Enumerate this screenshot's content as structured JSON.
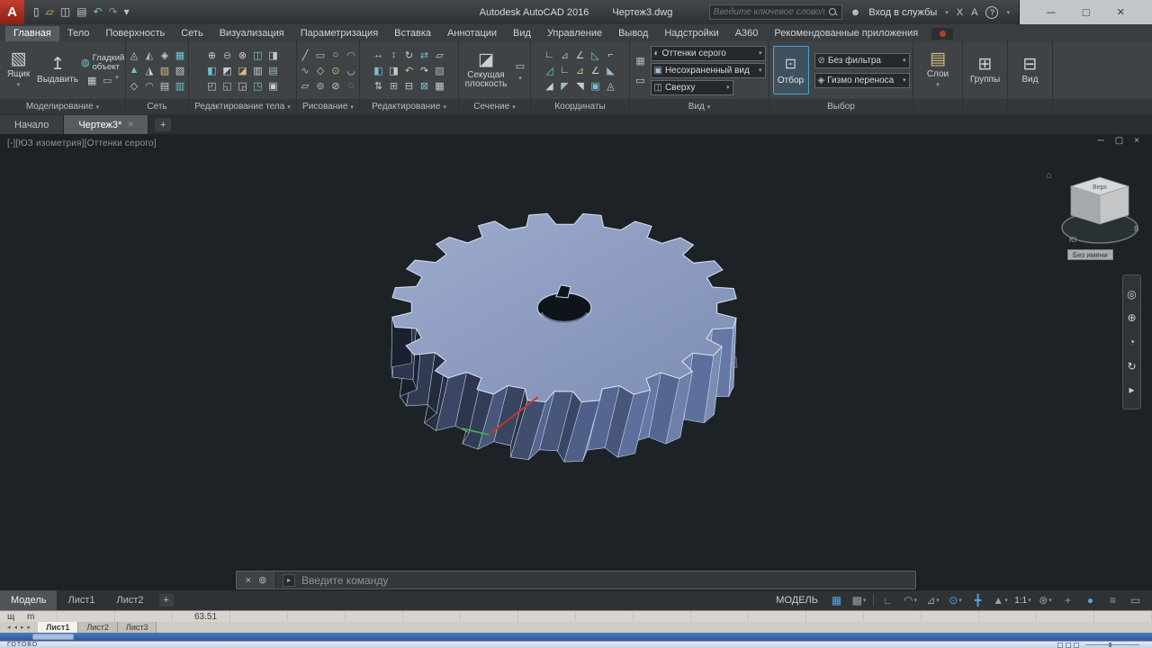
{
  "ui": {
    "caret": "▾",
    "close": "×",
    "plus": "+",
    "minimize": "─",
    "maximize": "□",
    "restore": "▢"
  },
  "colors": {
    "accent_blue": "#4da6e8",
    "gear_body": "#8e9dc1",
    "viewport_bg": "#1d2226",
    "logo_red": "#c43d31"
  },
  "titlebar": {
    "logo": "A",
    "qat": [
      {
        "name": "new-file",
        "g": "▯",
        "c": "#d9dcde"
      },
      {
        "name": "open-file",
        "g": "▱",
        "c": "#d8b65c"
      },
      {
        "name": "save-file",
        "g": "◫",
        "c": "#c7d6e4"
      },
      {
        "name": "plot",
        "g": "▤",
        "c": "#c0c5c9"
      },
      {
        "name": "undo",
        "g": "↶",
        "c": "#64c7d2"
      },
      {
        "name": "redo",
        "g": "↷",
        "c": "#8b9196"
      },
      {
        "name": "qat-menu",
        "g": "▾",
        "c": "#c0c5c9"
      }
    ],
    "app_title": "Autodesk AutoCAD 2016",
    "doc_title": "Чертеж3.dwg",
    "search_placeholder": "Введите ключевое слово/фразу",
    "signin": "Вход в службы",
    "exchange_glyph": "Χ",
    "a360_glyph": "A",
    "help_glyph": "?"
  },
  "ribbon_tabs": [
    {
      "label": "Главная",
      "active": true
    },
    {
      "label": "Тело"
    },
    {
      "label": "Поверхность"
    },
    {
      "label": "Сеть"
    },
    {
      "label": "Визуализация"
    },
    {
      "label": "Параметризация"
    },
    {
      "label": "Вставка"
    },
    {
      "label": "Аннотации"
    },
    {
      "label": "Вид"
    },
    {
      "label": "Управление"
    },
    {
      "label": "Вывод"
    },
    {
      "label": "Надстройки"
    },
    {
      "label": "A360"
    },
    {
      "label": "Рекомендованные приложения"
    }
  ],
  "icons": {
    "box": "▧",
    "extrude": "↥",
    "smooth": "◍",
    "section": "◪",
    "visual_style": "◐",
    "named_view": "▣",
    "plan_view": "◫",
    "cycle": "⊡",
    "no_filter": "⊘",
    "gizmo": "◈",
    "layers": "▤",
    "groups": "⊞",
    "viewport_cfg": "⊟",
    "small_a": "▭",
    "small_b": "▦"
  },
  "panels": {
    "modeling": {
      "label": "Моделирование",
      "box": "Ящик",
      "extrude": "Выдавить",
      "smooth": "Гладкий объект"
    },
    "mesh": {
      "label": "Сеть",
      "rows": [
        [
          "◬",
          "◭",
          "◈",
          "▦"
        ],
        [
          "▲",
          "◮",
          "▨",
          "▧"
        ],
        [
          "◇",
          "◠",
          "▤",
          "▥"
        ]
      ]
    },
    "solid_edit": {
      "label": "Редактирование тела",
      "rows": [
        [
          "⊕",
          "⊖",
          "⊗",
          "◫",
          "◨"
        ],
        [
          "◧",
          "◩",
          "◪",
          "▥",
          "▤"
        ],
        [
          "◰",
          "◱",
          "◲",
          "◳",
          "▣"
        ]
      ]
    },
    "draw": {
      "label": "Рисование",
      "rows": [
        [
          "╱",
          "▭",
          "○",
          "◠"
        ],
        [
          "∿",
          "◇",
          "⊙",
          "◡"
        ],
        [
          "▱",
          "⊚",
          "⊘",
          "◌"
        ]
      ]
    },
    "modify": {
      "label": "Редактирование",
      "rows": [
        [
          "↔",
          "↕",
          "↻",
          "⇄",
          "▱"
        ],
        [
          "◧",
          "◨",
          "↶",
          "↷",
          "▨"
        ],
        [
          "⇅",
          "⊞",
          "⊟",
          "⊠",
          "▦"
        ]
      ]
    },
    "section": {
      "label": "Сечение",
      "big": "Секущая плоскость"
    },
    "coords": {
      "label": "Координаты",
      "rows": [
        [
          "∟",
          "⊿",
          "∠",
          "◺",
          "⌐"
        ],
        [
          "◿",
          "∟",
          "⊿",
          "∠",
          "◣"
        ],
        [
          "◢",
          "◤",
          "◥",
          "▣",
          "◬"
        ]
      ]
    },
    "view": {
      "label": "Вид",
      "combos": [
        {
          "value": "Оттенки серого"
        },
        {
          "value": "Несохраненный вид"
        },
        {
          "value": "Сверху"
        }
      ]
    },
    "selection": {
      "label": "Выбор",
      "cycle": "Отбор",
      "filter": "Без фильтра",
      "gizmo": "Гизмо переноса"
    },
    "layers": {
      "big": "Слои"
    },
    "groups": {
      "big": "Группы"
    },
    "view2": {
      "big": "Вид"
    }
  },
  "file_tabs": [
    {
      "label": "Начало"
    },
    {
      "label": "Чертеж3*",
      "active": true
    }
  ],
  "viewport": {
    "label": "[-][ЮЗ изометрия][Оттенки серого]",
    "viewcube_top": "Верх",
    "viewcube_unnamed": "Без имени",
    "compass_e": "В",
    "compass_s": "Ю",
    "nav_icons": [
      {
        "name": "navigation-wheel-icon",
        "g": "◎"
      },
      {
        "name": "pan-icon",
        "g": "⊕"
      },
      {
        "name": "zoom-icon",
        "g": "◔"
      },
      {
        "name": "orbit-icon",
        "g": "↻"
      },
      {
        "name": "showmotion-icon",
        "g": "▸"
      }
    ]
  },
  "command": {
    "close": "×",
    "customize": "⊚",
    "prompt": "▸",
    "placeholder": "Введите команду"
  },
  "statusbar": {
    "tabs": [
      {
        "label": "Модель",
        "active": true
      },
      {
        "label": "Лист1"
      },
      {
        "label": "Лист2"
      }
    ],
    "add": "+",
    "mode": "МОДЕЛЬ",
    "icons": [
      {
        "g": "▦",
        "blue": true,
        "name": "grid-icon"
      },
      {
        "g": "▩",
        "caret": true,
        "name": "snap-icon"
      },
      {
        "sep": true
      },
      {
        "g": "∟",
        "blue": true,
        "name": "ortho-icon"
      },
      {
        "g": "◠",
        "caret": true,
        "name": "polar-tracking-icon"
      },
      {
        "g": "⊿",
        "caret": true,
        "name": "isodraft-icon"
      },
      {
        "g": "⊙",
        "blue": true,
        "caret": true,
        "name": "object-snap-icon"
      },
      {
        "g": "╋",
        "blue": true,
        "name": "snap-tracking-icon"
      },
      {
        "g": "▲",
        "caret": true,
        "name": "annotation-visibility-icon"
      },
      {
        "text": "1:1",
        "caret": true,
        "name": "annotation-scale-control"
      },
      {
        "g": "⊛",
        "caret": true,
        "name": "workspace-icon"
      },
      {
        "g": "+",
        "name": "customize-plus-icon"
      },
      {
        "g": "●",
        "blue": true,
        "name": "isolate-objects-icon"
      },
      {
        "g": "≡",
        "name": "customization-menu-icon"
      },
      {
        "g": "▭",
        "name": "clean-screen-icon"
      }
    ]
  },
  "excel": {
    "frag1": "щ",
    "frag2": "m",
    "cell_value": "63.51",
    "sheet_nav": [
      "◂",
      "◂",
      "▸",
      "▸"
    ],
    "sheets": [
      {
        "label": "Лист1",
        "active": true
      },
      {
        "label": "Лист2"
      },
      {
        "label": "Лист3"
      }
    ],
    "status": "ГОТОВО"
  }
}
